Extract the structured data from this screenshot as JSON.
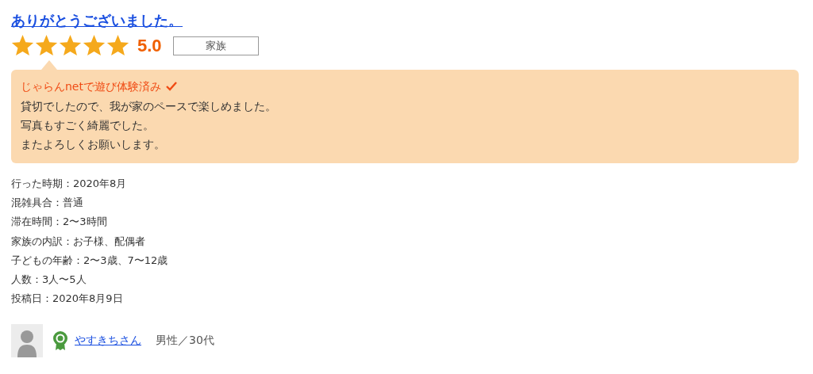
{
  "review": {
    "title": "ありがとうございました。",
    "stars": 5,
    "score": "5.0",
    "tag": "家族",
    "verified": "じゃらんnetで遊び体験済み",
    "body": [
      "貸切でしたので、我が家のペースで楽しめました。",
      "写真もすごく綺麗でした。",
      "またよろしくお願いします。"
    ],
    "details": [
      "行った時期：2020年8月",
      "混雑具合：普通",
      "滞在時間：2〜3時間",
      "家族の内訳：お子様、配偶者",
      "子どもの年齢：2〜3歳、7〜12歳",
      "人数：3人〜5人",
      "投稿日：2020年8月9日"
    ],
    "user": {
      "name": "やすきちさん",
      "profile": "男性／30代"
    }
  }
}
